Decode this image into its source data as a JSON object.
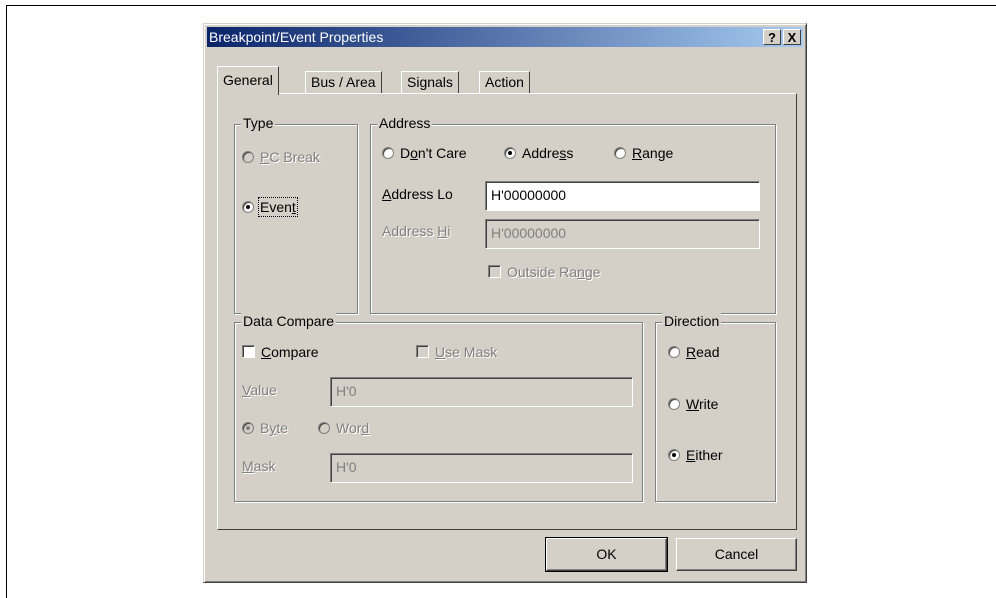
{
  "dialog": {
    "title": "Breakpoint/Event Properties",
    "help_label": "?",
    "close_label": "X"
  },
  "tabs": [
    {
      "label": "General",
      "active": true
    },
    {
      "label": "Bus / Area",
      "active": false
    },
    {
      "label": "Signals",
      "active": false
    },
    {
      "label": "Action",
      "active": false
    }
  ],
  "type_group": {
    "legend": "Type",
    "pc_break": {
      "pre": "",
      "u": "P",
      "post": "C Break",
      "checked": false,
      "enabled": false
    },
    "event": {
      "pre": "Even",
      "u": "t",
      "post": "",
      "checked": true,
      "enabled": true
    }
  },
  "address_group": {
    "legend": "Address",
    "dont_care": {
      "pre": "D",
      "u": "o",
      "post": "n't Care",
      "checked": false
    },
    "address": {
      "pre": "Addre",
      "u": "s",
      "post": "s",
      "checked": true
    },
    "range": {
      "pre": "",
      "u": "R",
      "post": "ange",
      "checked": false
    },
    "address_lo": {
      "pre": "",
      "u": "A",
      "post": "ddress Lo",
      "value": "H'00000000"
    },
    "address_hi": {
      "pre": "Address ",
      "u": "H",
      "post": "i",
      "value": "H'00000000"
    },
    "outside_range": {
      "pre": "Outside Ra",
      "u": "n",
      "post": "ge",
      "checked": false
    }
  },
  "data_compare": {
    "legend": "Data Compare",
    "compare": {
      "pre": "",
      "u": "C",
      "post": "ompare",
      "checked": false
    },
    "use_mask": {
      "pre": "",
      "u": "U",
      "post": "se Mask",
      "checked": false
    },
    "value": {
      "pre": "",
      "u": "V",
      "post": "alue",
      "value": "H'0"
    },
    "byte": {
      "pre": "B",
      "u": "y",
      "post": "te",
      "checked": true
    },
    "word": {
      "pre": "Wor",
      "u": "d",
      "post": "",
      "checked": false
    },
    "mask": {
      "pre": "",
      "u": "M",
      "post": "ask",
      "value": "H'0"
    }
  },
  "direction": {
    "legend": "Direction",
    "read": {
      "pre": "",
      "u": "R",
      "post": "ead",
      "checked": false
    },
    "write": {
      "pre": "",
      "u": "W",
      "post": "rite",
      "checked": false
    },
    "either": {
      "pre": "",
      "u": "E",
      "post": "ither",
      "checked": true
    }
  },
  "buttons": {
    "ok": "OK",
    "cancel": "Cancel"
  }
}
